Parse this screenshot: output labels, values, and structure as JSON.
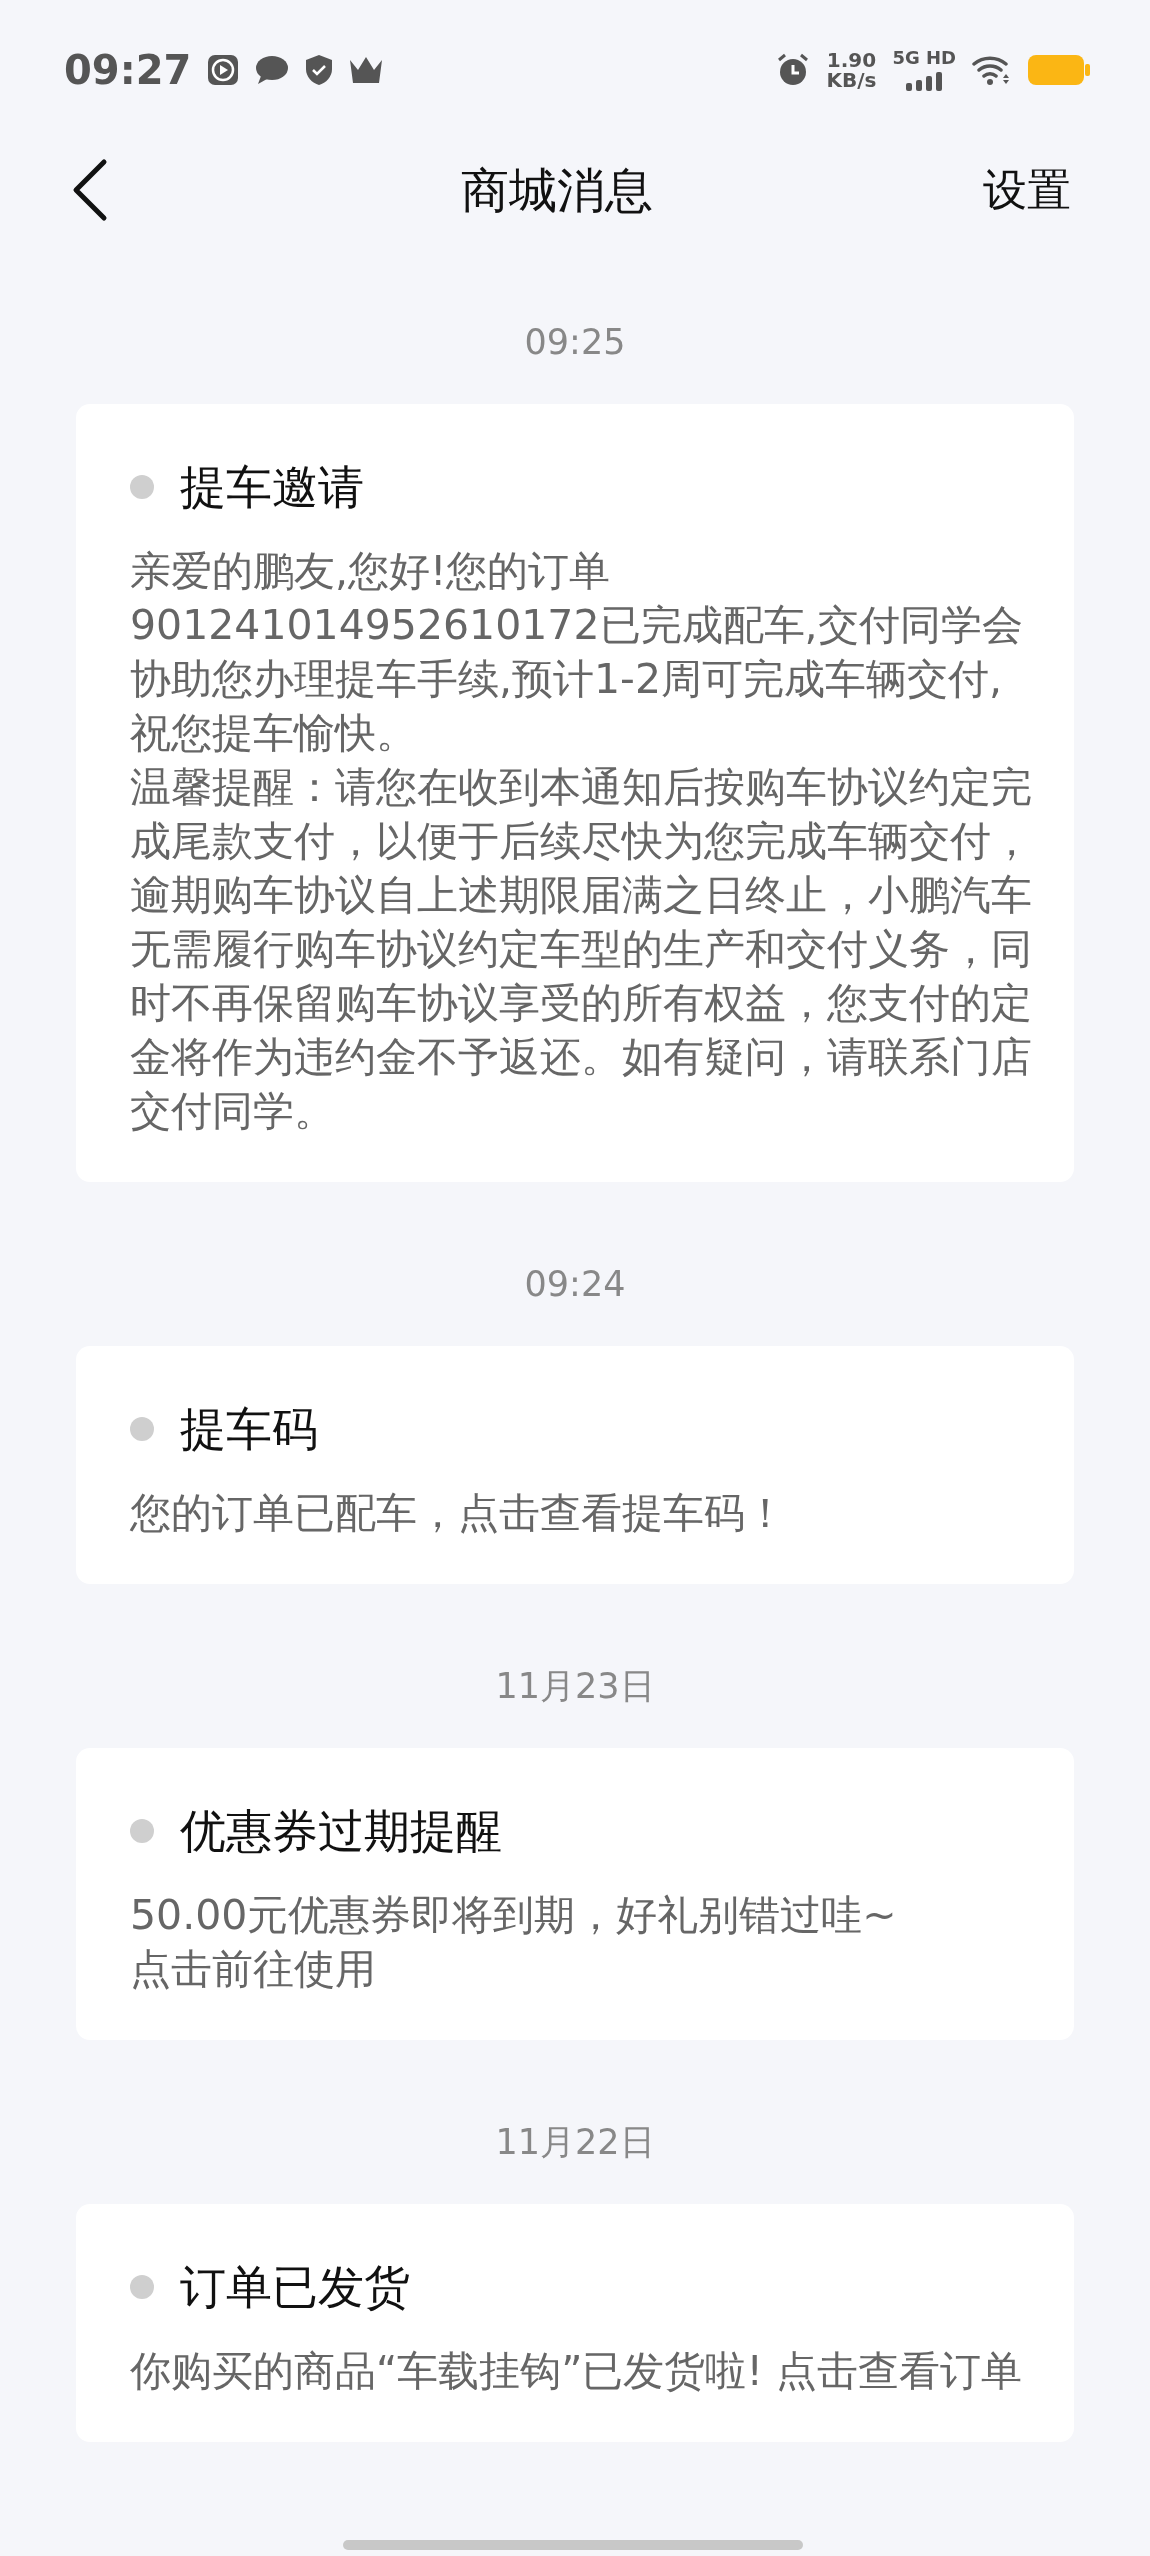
{
  "status_bar": {
    "time": "09:27",
    "speed_value": "1.90",
    "speed_unit": "KB/s",
    "network": "5G HD"
  },
  "header": {
    "title": "商城消息",
    "action": "设置"
  },
  "messages": [
    {
      "time": "09:25",
      "title": "提车邀请",
      "paragraphs": [
        "亲爱的鹏友,您好!您的订单901241014952610172已完成配车,交付同学会协助您办理提车手续,预计1-2周可完成车辆交付,祝您提车愉快。",
        "温馨提醒：请您在收到本通知后按购车协议约定完成尾款支付，以便于后续尽快为您完成车辆交付，逾期购车协议自上述期限届满之日终止，小鹏汽车无需履行购车协议约定车型的生产和交付义务，同时不再保留购车协议享受的所有权益，您支付的定金将作为违约金不予返还。如有疑问，请联系门店交付同学。"
      ]
    },
    {
      "time": "09:24",
      "title": "提车码",
      "paragraphs": [
        "您的订单已配车，点击查看提车码！"
      ]
    },
    {
      "time": "11月23日",
      "title": "优惠券过期提醒",
      "paragraphs": [
        "50.00元优惠券即将到期，好礼别错过哇~",
        "点击前往使用"
      ]
    },
    {
      "time": "11月22日",
      "title": "订单已发货",
      "paragraphs": [
        "你购买的商品“车载挂钩”已发货啦! 点击查看订单"
      ]
    }
  ]
}
